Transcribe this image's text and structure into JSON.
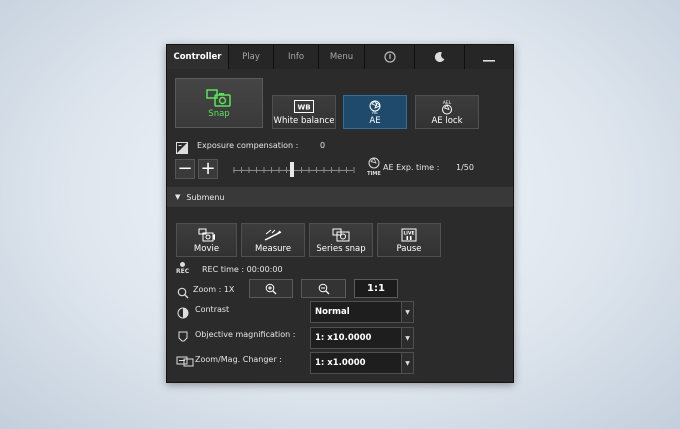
{
  "tabs": [
    {
      "label": "Controller",
      "active": true
    },
    {
      "label": "Play"
    },
    {
      "label": "Info"
    },
    {
      "label": "Menu"
    }
  ],
  "tab_icons": [
    "power-icon",
    "moon-icon",
    "minimize-icon"
  ],
  "buttons": {
    "snap": "Snap",
    "white_balance": "White balance",
    "ae": "AE",
    "ae_lock": "AE lock"
  },
  "exposure": {
    "label": "Exposure compensation :",
    "value": "0",
    "minus": "−",
    "plus": "+",
    "ae_time_label": "AE Exp. time :",
    "ae_time_value": "1/50"
  },
  "submenu": {
    "label": "Submenu",
    "buttons": [
      "Movie",
      "Measure",
      "Series snap",
      "Pause"
    ]
  },
  "rec": {
    "icon_text": "REC",
    "label": "REC time : 00:00:00"
  },
  "zoom": {
    "label": "Zoom : 1X",
    "one_to_one": "1:1"
  },
  "fields": {
    "contrast_label": "Contrast",
    "contrast_value": "Normal",
    "objective_label": "Objective magnification :",
    "objective_value": "1: x10.0000",
    "changer_label": "Zoom/Mag. Changer :",
    "changer_value": "1: x1.0000"
  },
  "colors": {
    "snap_green": "#5be45b",
    "ae_blue": "#1f4a6b",
    "panel_bg": "#2b2b2b"
  }
}
